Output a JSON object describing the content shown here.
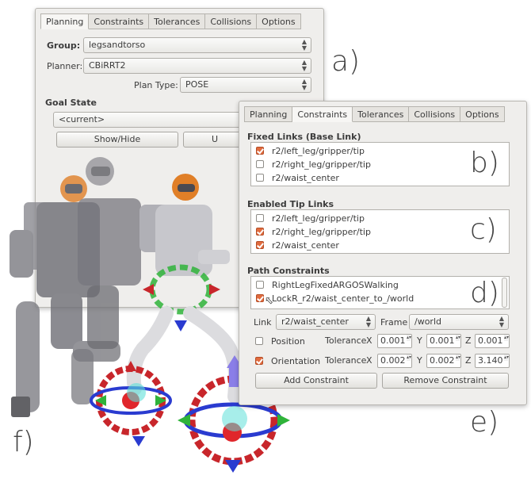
{
  "panel_a": {
    "tabs": [
      "Planning",
      "Constraints",
      "Tolerances",
      "Collisions",
      "Options"
    ],
    "group_label": "Group:",
    "group_value": "legsandtorso",
    "planner_label": "Planner:",
    "planner_value": "CBiRRT2",
    "plan_type_label": "Plan Type:",
    "plan_type_value": "POSE",
    "goal_state_label": "Goal State",
    "goal_state_value": "<current>",
    "show_hide_button": "Show/Hide",
    "partial_button": "U"
  },
  "panel_b": {
    "tabs": [
      "Planning",
      "Constraints",
      "Tolerances",
      "Collisions",
      "Options"
    ],
    "fixed_links_label": "Fixed Links (Base Link)",
    "fixed_links": [
      {
        "label": "r2/left_leg/gripper/tip",
        "checked": true
      },
      {
        "label": "r2/right_leg/gripper/tip",
        "checked": false
      },
      {
        "label": "r2/waist_center",
        "checked": false
      }
    ],
    "enabled_tips_label": "Enabled Tip Links",
    "enabled_tips": [
      {
        "label": "r2/left_leg/gripper/tip",
        "checked": false
      },
      {
        "label": "r2/right_leg/gripper/tip",
        "checked": true
      },
      {
        "label": "r2/waist_center",
        "checked": true
      }
    ],
    "path_constraints_label": "Path Constraints",
    "path_constraints": [
      {
        "label": "RightLegFixedARGOSWalking",
        "checked": false
      },
      {
        "label": "LockR_r2/waist_center_to_/world",
        "checked": true
      }
    ],
    "link_label": "Link",
    "link_value": "r2/waist_center",
    "frame_label": "Frame",
    "frame_value": "/world",
    "position_label": "Position",
    "position_checked": false,
    "orientation_label": "Orientation",
    "orientation_checked": true,
    "tolerance_label": "Tolerance",
    "axis_x": "X",
    "axis_y": "Y",
    "axis_z": "Z",
    "position_tolerance": {
      "x": "0.001",
      "y": "0.001",
      "z": "0.001"
    },
    "orientation_tolerance": {
      "x": "0.002",
      "y": "0.002",
      "z": "3.140"
    },
    "add_constraint_button": "Add Constraint",
    "remove_constraint_button": "Remove Constraint"
  },
  "callouts": {
    "a": "a)",
    "b": "b)",
    "c": "c)",
    "d": "d)",
    "e": "e)",
    "f": "f)"
  },
  "colors": {
    "checkbox_accent": "#e16b3e",
    "ring_red": "#c8262b",
    "ring_green": "#2fb33a",
    "ring_blue": "#2a3bd0",
    "robot_helmet": "#e07f28"
  }
}
